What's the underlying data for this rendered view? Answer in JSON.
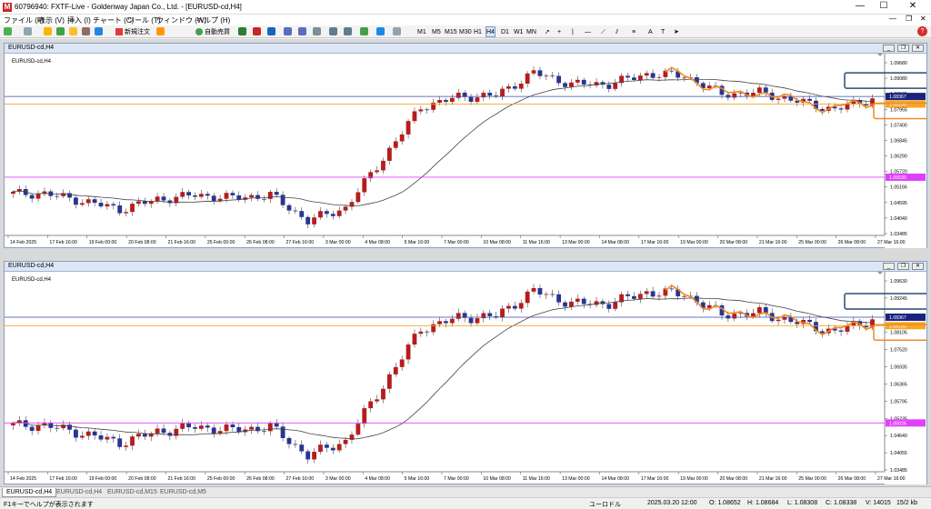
{
  "titlebar": {
    "title": "60796940: FXTF-Live - Goldenway Japan Co., Ltd. - [EURUSD-cd,H4]",
    "minimize": "—",
    "maximize": "☐",
    "close": "✕"
  },
  "menu": [
    "ファイル (F)",
    "表示 (V)",
    "挿入 (I)",
    "チャート (C)",
    "ツール (T)",
    "ウィンドウ (W)",
    "ヘルプ (H)"
  ],
  "toolbar": {
    "new_order": "新規注文",
    "auto_trade": "自動売買",
    "timeframes": [
      "M1",
      "M5",
      "M15",
      "M30",
      "H1",
      "H4",
      "D1",
      "W1",
      "MN"
    ],
    "active_timeframe": "H4"
  },
  "colors": {
    "bull": "#b71c1c",
    "bear": "#283593",
    "ma": "#444444",
    "blue_line": "#3949ab",
    "orange_line": "#f5a623",
    "pink_line": "#e040fb",
    "orange_box": "#f08a24",
    "navy_box": "#2c4a6e"
  },
  "charts": [
    {
      "window_title": "EURUSD-cd,H4",
      "inner_label": "EURUSD-cd,H4",
      "price_labels": [
        "1.09680",
        "1.09080",
        "1.08525",
        "1.07955",
        "1.07400",
        "1.06845",
        "1.06290",
        "1.05720",
        "1.05166",
        "1.04595",
        "1.04040",
        "1.03485"
      ],
      "date_labels": [
        "14 Feb 2025",
        "17 Feb 16:00",
        "19 Feb 00:00",
        "20 Feb 08:00",
        "21 Feb 16:00",
        "25 Feb 00:00",
        "26 Feb 08:00",
        "27 Feb 16:00",
        "3 Mar 00:00",
        "4 Mar 08:00",
        "5 Mar 16:00",
        "7 Mar 00:00",
        "10 Mar 08:00",
        "11 Mar 16:00",
        "13 Mar 00:00",
        "14 Mar 08:00",
        "17 Mar 16:00",
        "19 Mar 00:00",
        "20 Mar 08:00",
        "21 Mar 16:00",
        "25 Mar 00:00",
        "26 Mar 08:00",
        "27 Mar 16:00"
      ],
      "current_price": "1.08367",
      "orange_price": "1.08100",
      "pink_price": "1.05530"
    },
    {
      "window_title": "EURUSD-cd,H4",
      "inner_label": "EURUSD-cd,H4",
      "price_labels": [
        "1.09630",
        "1.09245",
        "1.08675",
        "1.08105",
        "1.07520",
        "1.06935",
        "1.06365",
        "1.05795",
        "1.05235",
        "1.04640",
        "1.04055",
        "1.03485"
      ],
      "date_labels": [
        "14 Feb 2025",
        "17 Feb 16:00",
        "19 Feb 00:00",
        "20 Feb 08:00",
        "21 Feb 16:00",
        "25 Feb 00:00",
        "26 Feb 08:00",
        "27 Feb 16:00",
        "3 Mar 00:00",
        "4 Mar 08:00",
        "5 Mar 16:00",
        "7 Mar 00:00",
        "10 Mar 08:00",
        "11 Mar 16:00",
        "13 Mar 00:00",
        "14 Mar 08:00",
        "17 Mar 16:00",
        "19 Mar 00:00",
        "20 Mar 08:00",
        "21 Mar 16:00",
        "25 Mar 00:00",
        "26 Mar 08:00",
        "27 Mar 16:00"
      ],
      "current_price": "1.08367",
      "orange_price": "1.08100",
      "pink_price": "1.05026"
    }
  ],
  "tabs": [
    "EURUSD-cd,H4",
    "EURUSD-cd,H4",
    "EURUSD-cd,M15",
    "EURUSD-cd,M5"
  ],
  "status": {
    "help": "F1キーでヘルプが表示されます",
    "symbol": "ユーロドル",
    "time": "2025.03.20 12:00",
    "open": "O: 1.08652",
    "high": "H: 1.08684",
    "low": "L: 1.08308",
    "close": "C: 1.08338",
    "volume": "V: 14015",
    "traffic": "15/2 kb"
  },
  "chart_data": [
    {
      "type": "candlestick",
      "symbol": "EURUSD-cd",
      "timeframe": "H4",
      "x": [
        "14 Feb 2025",
        "17 Feb 16:00",
        "19 Feb 00:00",
        "20 Feb 08:00",
        "21 Feb 16:00",
        "25 Feb 00:00",
        "26 Feb 08:00",
        "27 Feb 16:00",
        "3 Mar 00:00",
        "4 Mar 08:00",
        "5 Mar 16:00",
        "7 Mar 00:00",
        "10 Mar 08:00",
        "11 Mar 16:00",
        "13 Mar 00:00",
        "14 Mar 08:00",
        "17 Mar 16:00",
        "19 Mar 00:00",
        "20 Mar 08:00",
        "21 Mar 16:00",
        "25 Mar 00:00",
        "26 Mar 08:00",
        "27 Mar 16:00"
      ],
      "close": [
        1.0495,
        1.047,
        1.044,
        1.0475,
        1.049,
        1.048,
        1.049,
        1.04,
        1.0445,
        1.062,
        1.08,
        1.0835,
        1.084,
        1.092,
        1.088,
        1.088,
        1.0915,
        1.091,
        1.0845,
        1.085,
        1.082,
        1.079,
        1.083
      ],
      "ylim": [
        1.03485,
        1.0968
      ],
      "current_price": 1.08367,
      "orange_line": 1.081,
      "pink_line": 1.0553
    },
    {
      "type": "candlestick",
      "symbol": "EURUSD-cd",
      "timeframe": "H4",
      "x": [
        "14 Feb 2025",
        "17 Feb 16:00",
        "19 Feb 00:00",
        "20 Feb 08:00",
        "21 Feb 16:00",
        "25 Feb 00:00",
        "26 Feb 08:00",
        "27 Feb 16:00",
        "3 Mar 00:00",
        "4 Mar 08:00",
        "5 Mar 16:00",
        "7 Mar 00:00",
        "10 Mar 08:00",
        "11 Mar 16:00",
        "13 Mar 00:00",
        "14 Mar 08:00",
        "17 Mar 16:00",
        "19 Mar 00:00",
        "20 Mar 08:00",
        "21 Mar 16:00",
        "25 Mar 00:00",
        "26 Mar 08:00",
        "27 Mar 16:00"
      ],
      "close": [
        1.0495,
        1.047,
        1.044,
        1.0475,
        1.049,
        1.048,
        1.049,
        1.04,
        1.0445,
        1.062,
        1.08,
        1.0835,
        1.084,
        1.092,
        1.088,
        1.088,
        1.0915,
        1.091,
        1.0845,
        1.085,
        1.082,
        1.079,
        1.083
      ],
      "ylim": [
        1.03485,
        1.0963
      ],
      "current_price": 1.08367,
      "orange_line": 1.081,
      "pink_line": 1.05026
    }
  ]
}
